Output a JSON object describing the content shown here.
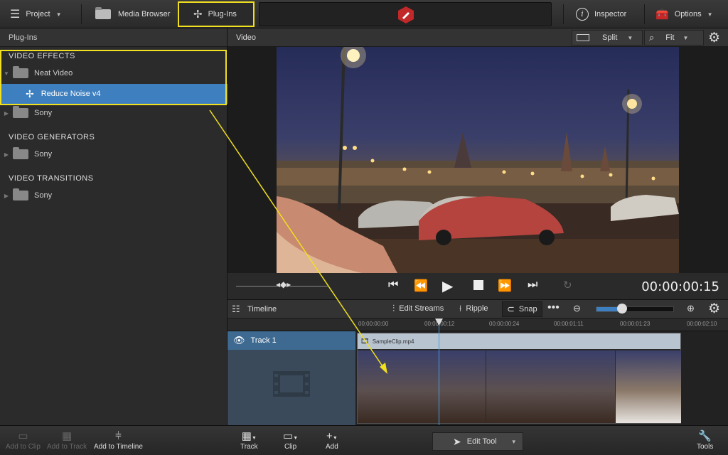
{
  "toolbar": {
    "project": "Project",
    "media_browser": "Media Browser",
    "plugins": "Plug-Ins",
    "inspector": "Inspector",
    "options": "Options"
  },
  "left_panel": {
    "title": "Plug-Ins",
    "sections": [
      {
        "title": "VIDEO EFFECTS"
      },
      {
        "title": "VIDEO GENERATORS"
      },
      {
        "title": "VIDEO TRANSITIONS"
      }
    ],
    "items": {
      "neat_video": "Neat Video",
      "reduce_noise": "Reduce Noise v4",
      "sony_effects": "Sony",
      "sony_generators": "Sony",
      "sony_transitions": "Sony"
    }
  },
  "video": {
    "title": "Video",
    "split": "Split",
    "fit": "Fit",
    "timecode": "00:00:00:15"
  },
  "timeline": {
    "title": "Timeline",
    "edit_streams": "Edit Streams",
    "ripple": "Ripple",
    "snap": "Snap",
    "ruler": [
      "00:00:00:00",
      "00:00:00:12",
      "00:00:00:24",
      "00:00:01:11",
      "00:00:01:23",
      "00:00:02:10"
    ],
    "track_name": "Track 1",
    "clip_name": "SampleClip.mp4",
    "zoom_level": 0.33
  },
  "bottom": {
    "add_to_clip": "Add to Clip",
    "add_to_track": "Add to Track",
    "add_to_timeline": "Add to Timeline",
    "track": "Track",
    "clip": "Clip",
    "add": "Add",
    "edit_tool": "Edit Tool",
    "tools": "Tools"
  },
  "colors": {
    "accent": "#3e7fbf",
    "highlight": "#f0e020",
    "app_badge": "#c0282a"
  }
}
